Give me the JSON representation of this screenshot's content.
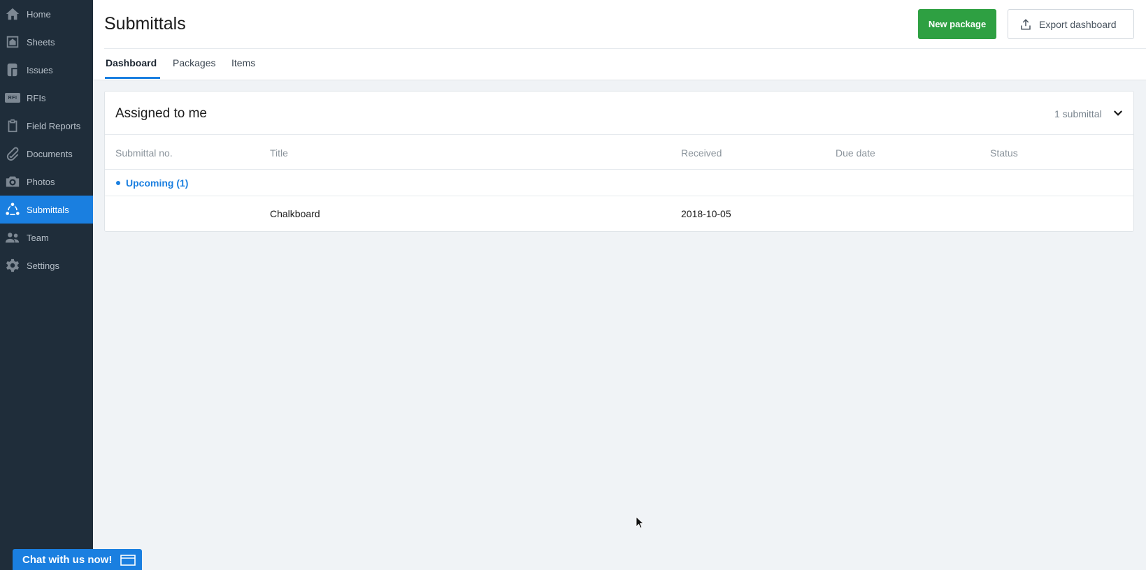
{
  "sidebar": {
    "items": [
      {
        "label": "Home",
        "icon": "home-icon"
      },
      {
        "label": "Sheets",
        "icon": "sheets-icon"
      },
      {
        "label": "Issues",
        "icon": "issues-icon"
      },
      {
        "label": "RFIs",
        "icon": "rfi-icon",
        "badge": "RFI"
      },
      {
        "label": "Field Reports",
        "icon": "clipboard-icon"
      },
      {
        "label": "Documents",
        "icon": "paperclip-icon"
      },
      {
        "label": "Photos",
        "icon": "camera-icon"
      },
      {
        "label": "Submittals",
        "icon": "submittals-icon",
        "active": true
      },
      {
        "label": "Team",
        "icon": "team-icon"
      },
      {
        "label": "Settings",
        "icon": "gear-icon"
      }
    ]
  },
  "header": {
    "title": "Submittals",
    "new_package_label": "New package",
    "export_label": "Export dashboard",
    "tabs": [
      {
        "label": "Dashboard",
        "active": true
      },
      {
        "label": "Packages"
      },
      {
        "label": "Items"
      }
    ]
  },
  "card": {
    "title": "Assigned to me",
    "count": "1 submittal",
    "columns": [
      "Submittal no.",
      "Title",
      "Received",
      "Due date",
      "Status"
    ],
    "group_label": "Upcoming (1)",
    "rows": [
      {
        "submittal_no": "",
        "title": "Chalkboard",
        "received": "2018-10-05",
        "due_date": "",
        "status": ""
      }
    ]
  },
  "chat": {
    "label": "Chat with us now!"
  },
  "colors": {
    "sidebar_bg": "#1f2d3a",
    "accent": "#1a7fe0",
    "primary_button": "#2ea042",
    "page_bg": "#f0f3f6"
  }
}
